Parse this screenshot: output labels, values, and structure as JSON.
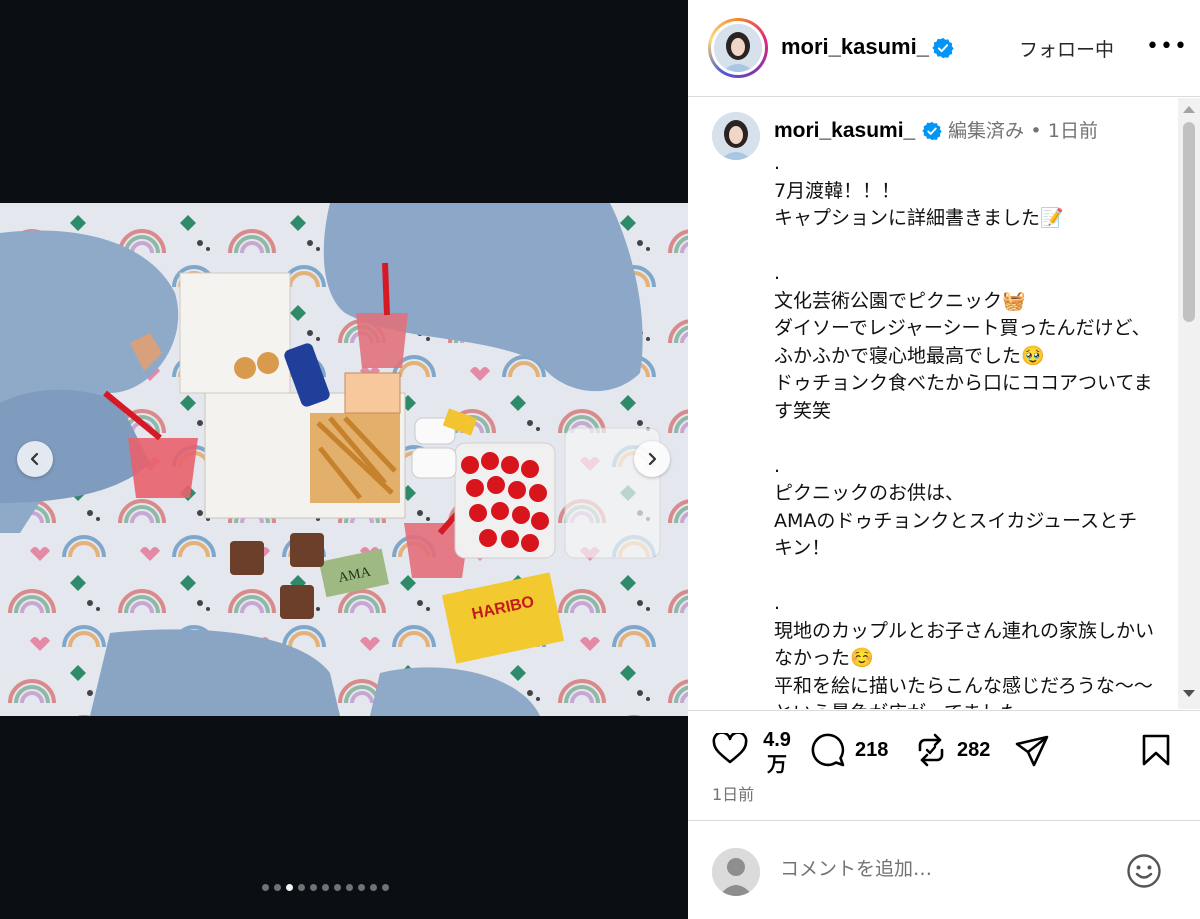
{
  "post": {
    "username": "mori_kasumi_",
    "follow_label": "フォロー中",
    "more_label": "•••",
    "caption_edited": "編集済み",
    "caption_sep": "•",
    "caption_time": "1日前",
    "caption_text": ".\n7月渡韓！！！\nキャプションに詳細書きました📝\n\n.\n文化芸術公園でピクニック🧺\nダイソーでレジャーシート買ったんだけど、ふかふかで寝心地最高でした🥹\nドゥチョンク食べたから口にココアついてます笑笑\n\n.\nピクニックのお供は、\nAMAのドゥチョンクとスイカジュースとチキン！\n\n.\n現地のカップルとお子さん連れの家族しかいなかった☺️\n平和を絵に描いたらこんな感じだろうな〜〜という景色が広がってました。",
    "likes": "4.9",
    "likes_unit": "万",
    "comments": "218",
    "reposts": "282",
    "posted_ago": "1日前"
  },
  "carousel": {
    "total_slides": 11,
    "active_index": 2,
    "photo_label_ama": "AMA",
    "photo_label_haribo": "HARIBO"
  },
  "comment_box": {
    "placeholder": "コメントを追加…"
  },
  "colors": {
    "verified_blue": "#0095f6",
    "media_bg": "#0b0f14",
    "muted_text": "#737373",
    "divider": "#dbdbdb"
  },
  "icons": {
    "like": "heart-icon",
    "comment": "speech-bubble-icon",
    "repost": "repost-icon",
    "share": "paper-plane-icon",
    "save": "bookmark-icon",
    "emoji": "smiley-icon",
    "prev": "chevron-left-icon",
    "next": "chevron-right-icon"
  }
}
